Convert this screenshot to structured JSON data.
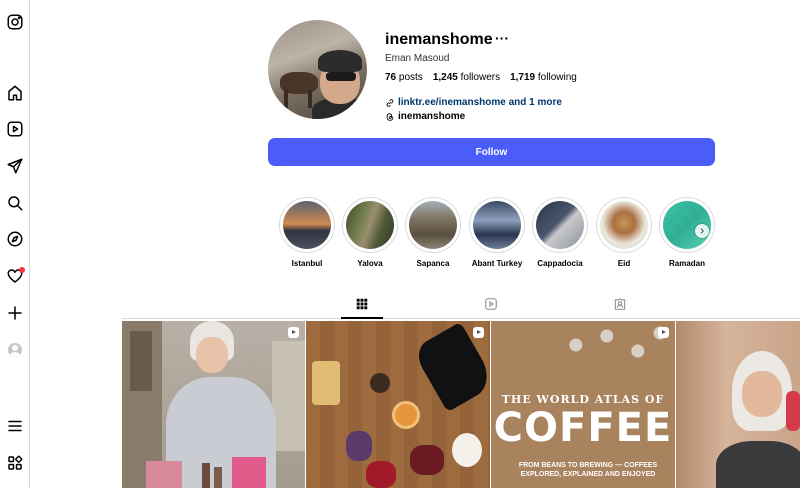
{
  "nav": {
    "items": [
      {
        "icon": "instagram-logo-icon"
      },
      {
        "icon": "home-icon"
      },
      {
        "icon": "reels-icon"
      },
      {
        "icon": "messages-icon"
      },
      {
        "icon": "search-icon"
      },
      {
        "icon": "explore-icon"
      },
      {
        "icon": "notifications-icon",
        "badge": true
      },
      {
        "icon": "create-icon"
      },
      {
        "icon": "profile-icon"
      },
      {
        "icon": "more-menu-icon"
      },
      {
        "icon": "also-from-meta-icon"
      }
    ]
  },
  "profile": {
    "username": "inemanshome",
    "more": "···",
    "full_name": "Eman Masoud",
    "posts_count": "76",
    "posts_label": "posts",
    "followers_count": "1,245",
    "followers_label": "followers",
    "following_count": "1,719",
    "following_label": "following",
    "link_text": "linktr.ee/inemanshome and 1 more",
    "threads_handle": "inemanshome",
    "follow_label": "Follow"
  },
  "highlights": [
    {
      "label": "Istanbul"
    },
    {
      "label": "Yalova"
    },
    {
      "label": "Sapanca"
    },
    {
      "label": "Abant Turkey"
    },
    {
      "label": "Cappadocia"
    },
    {
      "label": "Eid"
    },
    {
      "label": "Ramadan"
    }
  ],
  "tabs": [
    {
      "icon": "posts-grid-icon",
      "active": true
    },
    {
      "icon": "reels-tab-icon",
      "active": false
    },
    {
      "icon": "tagged-icon",
      "active": false
    }
  ],
  "posts": [
    {
      "kind": "reel"
    },
    {
      "kind": "reel"
    },
    {
      "kind": "reel",
      "book": {
        "line1": "THE WORLD ATLAS OF",
        "line2": "COFFEE",
        "subtitle": "FROM BEANS TO BREWING — COFFEES EXPLORED, EXPLAINED AND ENJOYED"
      }
    },
    {
      "kind": "post"
    }
  ],
  "colors": {
    "follow_button": "#4a5df9",
    "notification_dot": "#ff3040",
    "link": "#00376b"
  }
}
